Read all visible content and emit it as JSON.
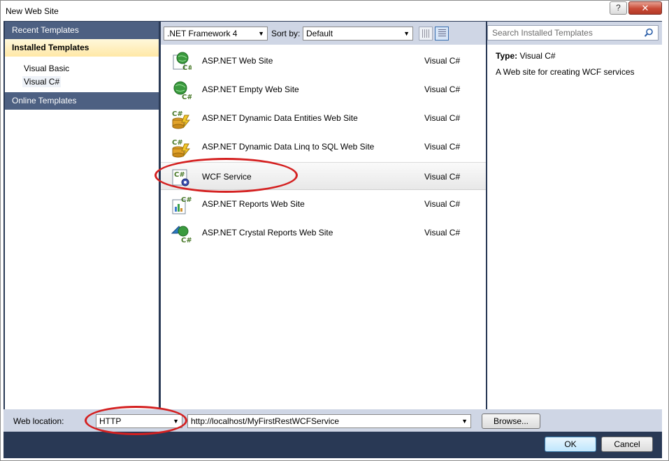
{
  "window": {
    "title": "New Web Site",
    "help_label": "?",
    "close_label": "✕"
  },
  "sidebar": {
    "recent": "Recent Templates",
    "installed": "Installed Templates",
    "items": [
      {
        "label": "Visual Basic"
      },
      {
        "label": "Visual C#"
      }
    ],
    "online": "Online Templates"
  },
  "toolbar": {
    "framework": ".NET Framework 4",
    "sort_label": "Sort by:",
    "sort_value": "Default"
  },
  "search": {
    "placeholder": "Search Installed Templates"
  },
  "templates": [
    {
      "name": "ASP.NET Web Site",
      "lang": "Visual C#"
    },
    {
      "name": "ASP.NET Empty Web Site",
      "lang": "Visual C#"
    },
    {
      "name": "ASP.NET Dynamic Data Entities Web Site",
      "lang": "Visual C#"
    },
    {
      "name": "ASP.NET Dynamic Data Linq to SQL Web Site",
      "lang": "Visual C#"
    },
    {
      "name": "WCF Service",
      "lang": "Visual C#"
    },
    {
      "name": "ASP.NET Reports Web Site",
      "lang": "Visual C#"
    },
    {
      "name": "ASP.NET Crystal Reports Web Site",
      "lang": "Visual C#"
    }
  ],
  "details": {
    "type_label": "Type:",
    "type_value": "Visual C#",
    "description": "A Web site for creating WCF services"
  },
  "location": {
    "label": "Web location:",
    "protocol": "HTTP",
    "url": "http://localhost/MyFirstRestWCFService",
    "browse": "Browse..."
  },
  "buttons": {
    "ok": "OK",
    "cancel": "Cancel"
  },
  "colors": {
    "panel_dark": "#293955",
    "header_blue": "#4d6082",
    "annotation_red": "#d42020"
  }
}
